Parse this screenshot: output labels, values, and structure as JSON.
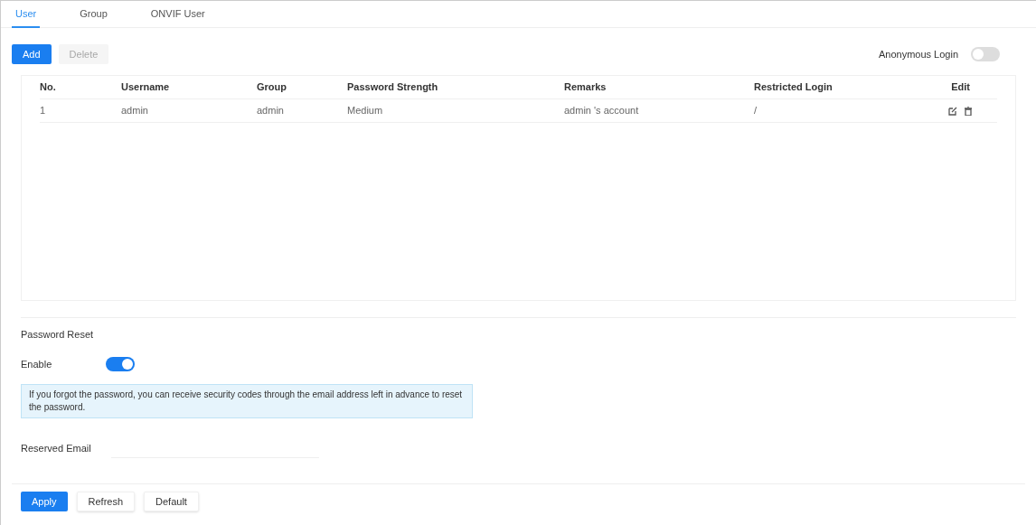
{
  "tabs": [
    {
      "label": "User",
      "selected": true
    },
    {
      "label": "Group",
      "selected": false
    },
    {
      "label": "ONVIF User",
      "selected": false
    }
  ],
  "toolbar": {
    "buttons": [
      {
        "label": "Add",
        "disabled": false
      },
      {
        "label": "Delete",
        "disabled": true
      }
    ],
    "anonymous_login": {
      "label": "Anonymous Login",
      "on": false
    }
  },
  "table": {
    "columns": [
      "No.",
      "Username",
      "Group",
      "Password Strength",
      "Remarks",
      "Restricted Login",
      "Edit"
    ],
    "rows": [
      {
        "cells": [
          "1",
          "admin",
          "admin",
          "Medium",
          "admin 's account",
          "/"
        ]
      }
    ]
  },
  "password_reset": {
    "title": "Password Reset",
    "enable": {
      "label": "Enable",
      "on": true
    },
    "info": "If you forgot the password, you can receive security codes through the email address left in advance to reset the password.",
    "reserved_email": {
      "label": "Reserved Email"
    }
  },
  "footer_buttons": [
    {
      "label": "Apply",
      "kind": "primary"
    },
    {
      "label": "Refresh",
      "kind": "plain"
    },
    {
      "label": "Default",
      "kind": "plain"
    }
  ]
}
